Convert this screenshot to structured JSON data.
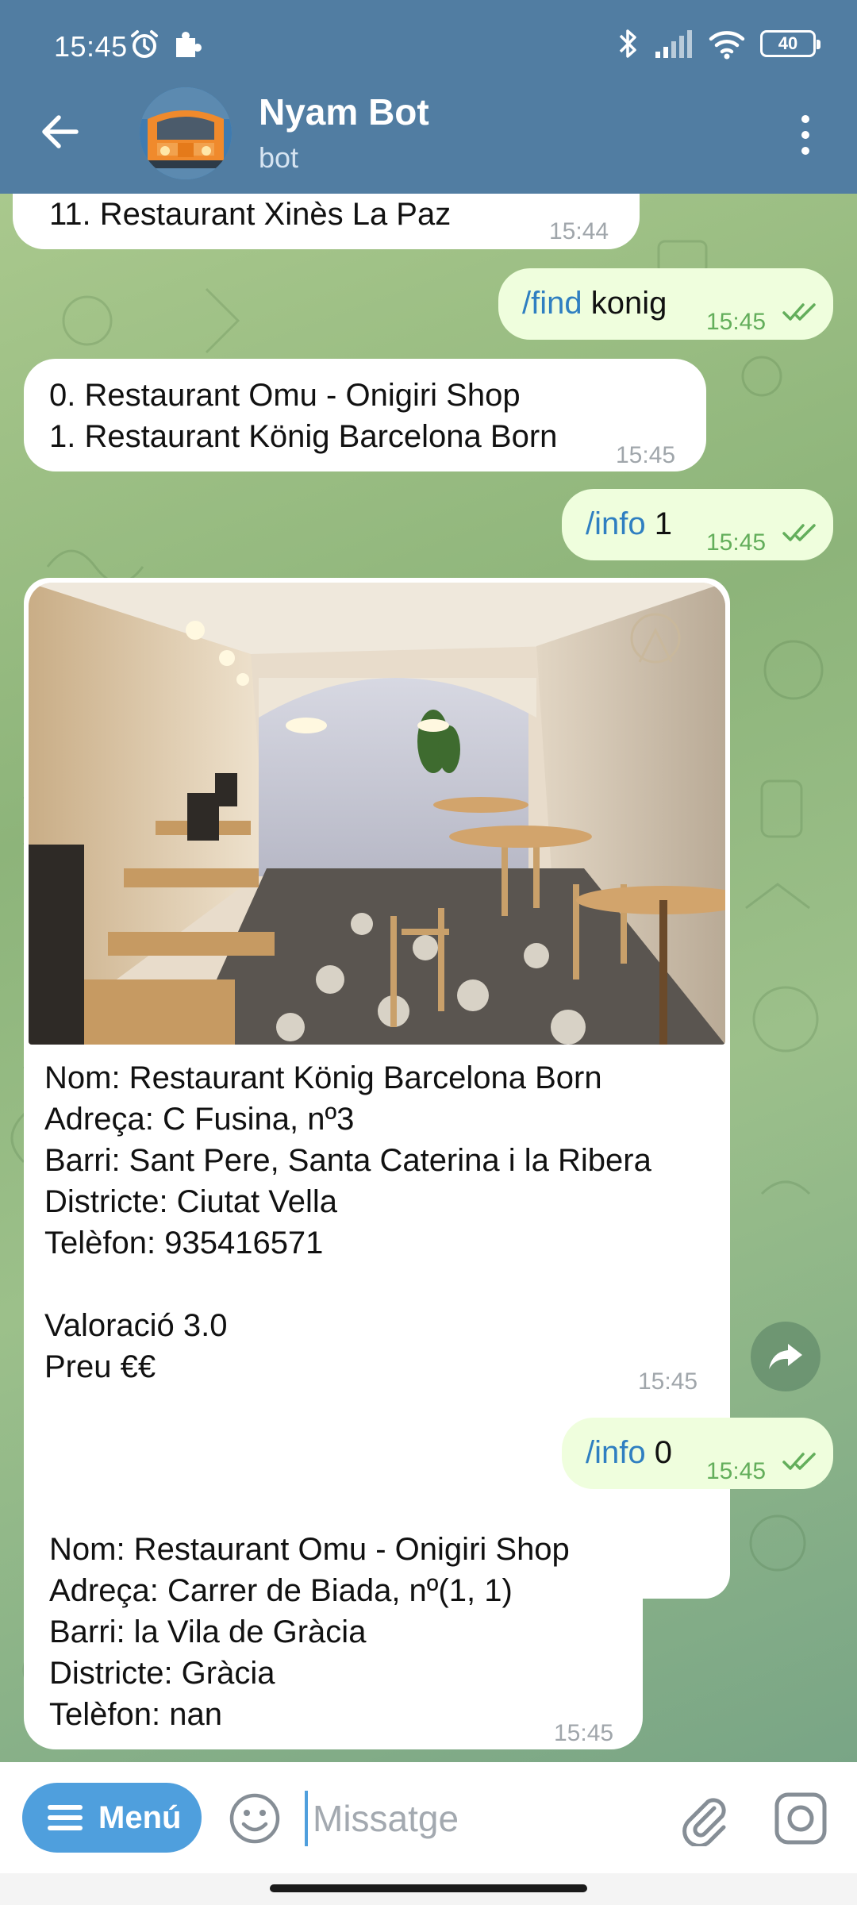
{
  "status_bar": {
    "time": "15:45",
    "battery": "40",
    "icons": [
      "alarm-icon",
      "puzzle-icon",
      "bluetooth-icon",
      "signal-icon",
      "wifi-icon",
      "battery-icon"
    ]
  },
  "header": {
    "title": "Nyam Bot",
    "subtitle": "bot",
    "header_color": "#517da2"
  },
  "messages": [
    {
      "direction": "in",
      "lines": [
        "11. Restaurant Xinès La Paz"
      ],
      "time": "15:44"
    },
    {
      "direction": "out",
      "command": "/find",
      "arg": "konig",
      "time": "15:45",
      "status": "read"
    },
    {
      "direction": "in",
      "lines": [
        "0. Restaurant Omu - Onigiri Shop",
        "1. Restaurant König Barcelona Born"
      ],
      "time": "15:45"
    },
    {
      "direction": "out",
      "command": "/info",
      "arg": "1",
      "time": "15:45",
      "status": "read"
    },
    {
      "direction": "in",
      "has_photo": true,
      "lines": [
        "Nom: Restaurant König Barcelona Born",
        "Adreça: C Fusina, nº3",
        "Barri: Sant Pere, Santa Caterina i la Ribera",
        "Districte: Ciutat Vella",
        "Telèfon: 935416571",
        "",
        "Valoració 3.0",
        "Preu €€"
      ],
      "time": "15:45"
    },
    {
      "direction": "out",
      "command": "/info",
      "arg": "0",
      "time": "15:45",
      "status": "read"
    },
    {
      "direction": "in",
      "lines": [
        "Nom: Restaurant Omu - Onigiri Shop",
        "Adreça: Carrer de Biada, nº(1, 1)",
        "Barri: la Vila de Gràcia",
        "Districte: Gràcia",
        "Telèfon: nan"
      ],
      "time": "15:45"
    }
  ],
  "input": {
    "menu_label": "Menú",
    "placeholder": "Missatge",
    "value": ""
  },
  "colors": {
    "accent": "#4f9fdd",
    "outgoing_bubble": "#effedd",
    "incoming_bubble": "#ffffff",
    "command_link": "#2f7fc1",
    "read_check": "#63ae5b"
  }
}
